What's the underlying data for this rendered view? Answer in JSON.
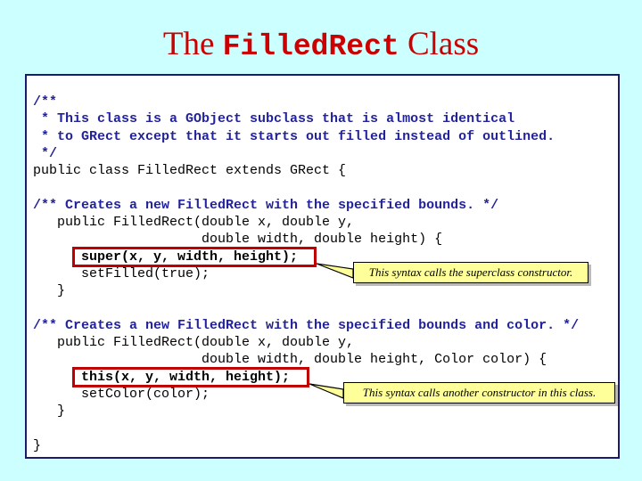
{
  "slide": {
    "background_color": "#CCFFFF",
    "title": {
      "prefix": "The ",
      "mono": "FilledRect",
      "suffix": " Class",
      "color": "#CC0000"
    },
    "panel": {
      "background_color": "#FFFFFF",
      "border_color": "#1A1A6E"
    }
  },
  "code": {
    "comment_color": "#22229C",
    "text_color": "#000000",
    "lines": [
      {
        "id": "l01",
        "text": "/**",
        "style": "comment"
      },
      {
        "id": "l02",
        "text": " * This class is a GObject subclass that is almost identical",
        "style": "comment"
      },
      {
        "id": "l03",
        "text": " * to GRect except that it starts out filled instead of outlined.",
        "style": "comment"
      },
      {
        "id": "l04",
        "text": " */",
        "style": "comment"
      },
      {
        "id": "l05",
        "text": "public class FilledRect extends GRect {",
        "style": "plain"
      },
      {
        "id": "l06",
        "text": "",
        "style": "blank"
      },
      {
        "id": "l07",
        "text": "/** Creates a new FilledRect with the specified bounds. */",
        "style": "comment"
      },
      {
        "id": "l08",
        "text": "   public FilledRect(double x, double y,",
        "style": "plain"
      },
      {
        "id": "l09",
        "text": "                     double width, double height) {",
        "style": "plain"
      },
      {
        "id": "l10",
        "text": "      super(x, y, width, height);",
        "style": "bold"
      },
      {
        "id": "l11",
        "text": "      setFilled(true);",
        "style": "plain"
      },
      {
        "id": "l12",
        "text": "   }",
        "style": "plain"
      },
      {
        "id": "l13",
        "text": "",
        "style": "blank"
      },
      {
        "id": "l14",
        "text": "/** Creates a new FilledRect with the specified bounds and color. */",
        "style": "comment"
      },
      {
        "id": "l15",
        "text": "   public FilledRect(double x, double y,",
        "style": "plain"
      },
      {
        "id": "l16",
        "text": "                     double width, double height, Color color) {",
        "style": "plain"
      },
      {
        "id": "l17",
        "text": "      this(x, y, width, height);",
        "style": "bold"
      },
      {
        "id": "l18",
        "text": "      setColor(color);",
        "style": "plain"
      },
      {
        "id": "l19",
        "text": "   }",
        "style": "plain"
      },
      {
        "id": "l20",
        "text": "",
        "style": "blank"
      },
      {
        "id": "l21",
        "text": "}",
        "style": "plain"
      }
    ]
  },
  "highlights": {
    "border_color": "#C00000",
    "boxes": [
      {
        "id": "redbox-super",
        "target_text": "super(x, y, width, height);"
      },
      {
        "id": "redbox-this",
        "target_text": "this(x, y, width, height);"
      }
    ]
  },
  "callouts": {
    "fill_color": "#FFFF99",
    "border_color": "#000000",
    "items": [
      {
        "id": "callout-super",
        "text": "This syntax calls the superclass constructor."
      },
      {
        "id": "callout-this",
        "text": "This syntax calls another constructor in this class."
      }
    ]
  }
}
